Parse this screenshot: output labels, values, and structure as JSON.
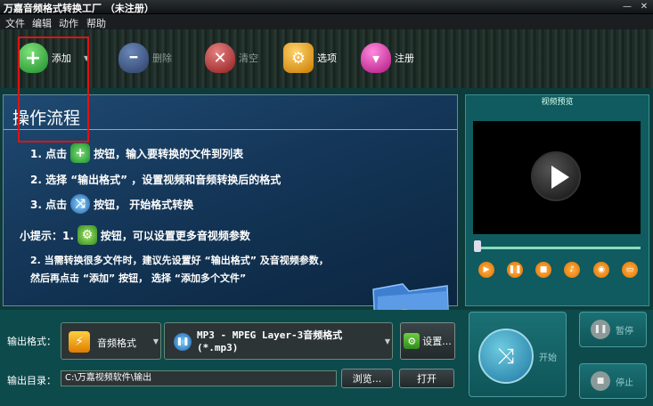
{
  "window": {
    "title": "万嘉音频格式转换工厂  （未注册）",
    "minimize": "—",
    "close": "✕"
  },
  "menu": [
    "文件",
    "编辑",
    "动作",
    "帮助"
  ],
  "toolbar": {
    "add": "添加",
    "delete": "删除",
    "clear": "清空",
    "options": "选项",
    "register": "注册"
  },
  "flow": {
    "heading": "操作流程",
    "step1_a": "1. 点击",
    "step1_b": "按钮，输入要转换的文件到列表",
    "step2": "2. 选择 “输出格式” ，设置视频和音频转换后的格式",
    "step3_a": "3. 点击",
    "step3_b": "按钮， 开始格式转换",
    "tip_a": "小提示：1.",
    "tip_b": "按钮，可以设置更多音视频参数",
    "tip2_line1": "2. 当需转换很多文件时，建议先设置好 “输出格式” 及音视频参数，",
    "tip2_line2": "然后再点击 “添加” 按钮， 选择 “添加多个文件”"
  },
  "preview": {
    "title": "视频预览"
  },
  "output": {
    "format_label": "输出格式：",
    "format_value": "音频格式",
    "codec_line1": "MP3 - MPEG Layer-3音频格式",
    "codec_line2": "(*.mp3)",
    "settings": "设置...",
    "dir_label": "输出目录：",
    "dir_value": "C:\\万嘉视频软件\\输出",
    "browse": "浏览...",
    "open": "打开"
  },
  "actions": {
    "start": "开始",
    "pause": "暂停",
    "stop": "停止"
  }
}
